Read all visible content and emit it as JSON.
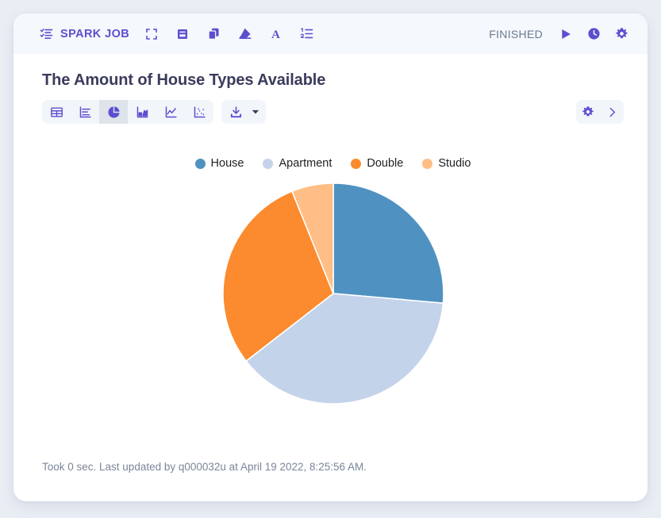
{
  "header": {
    "job_label": "SPARK JOB",
    "job_icon": "checklist-icon",
    "icons": [
      {
        "name": "fullscreen-icon"
      },
      {
        "name": "book-icon"
      },
      {
        "name": "copy-icon"
      },
      {
        "name": "eraser-icon"
      },
      {
        "name": "font-icon"
      },
      {
        "name": "ordered-list-icon"
      }
    ],
    "status": "FINISHED",
    "actions": [
      {
        "name": "run-icon"
      },
      {
        "name": "clock-icon"
      },
      {
        "name": "gear-icon"
      }
    ]
  },
  "viz": {
    "title": "The Amount of House Types Available",
    "toolbar": [
      {
        "name": "table-view-button",
        "selected": false
      },
      {
        "name": "bar-chart-button",
        "selected": false
      },
      {
        "name": "pie-chart-button",
        "selected": true
      },
      {
        "name": "area-chart-button",
        "selected": false
      },
      {
        "name": "line-chart-button",
        "selected": false
      },
      {
        "name": "scatter-chart-button",
        "selected": false
      }
    ],
    "download": {
      "name": "download-button",
      "caret": "chevron-down-icon"
    },
    "settings": {
      "gear": "gear-icon",
      "expand": "chevron-right-icon"
    },
    "footer": "Took 0 sec. Last updated by q000032u at April 19 2022, 8:25:56 AM."
  },
  "colors": {
    "accent_purple": "#5b4fcf",
    "page_bg": "#e9edf4",
    "header_bg": "#f5f8fc",
    "title": "#3b3b5c",
    "status": "#6b7a90",
    "footer": "#7a8798"
  },
  "chart_data": {
    "type": "pie",
    "title": "The Amount of House Types Available",
    "categories": [
      "House",
      "Apartment",
      "Double",
      "Studio"
    ],
    "values": [
      26.4,
      38.1,
      29.4,
      6.1
    ],
    "colors": [
      "#4f92c2",
      "#c3d3ea",
      "#fb8b2e",
      "#ffbe85"
    ],
    "legend_position": "top",
    "start_angle": 0,
    "direction": "clockwise",
    "slice_border": "#ffffff",
    "radius": 139,
    "center": [
      416,
      383
    ]
  }
}
